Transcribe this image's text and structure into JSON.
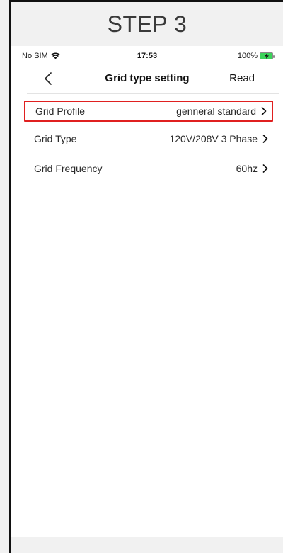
{
  "step_title": "STEP 3",
  "status_bar": {
    "carrier": "No SIM",
    "time": "17:53",
    "battery": "100%"
  },
  "nav": {
    "title": "Grid type setting",
    "action": "Read"
  },
  "settings": [
    {
      "label": "Grid Profile",
      "value": "genneral standard",
      "highlighted": true
    },
    {
      "label": "Grid Type",
      "value": "120V/208V 3 Phase",
      "highlighted": false
    },
    {
      "label": "Grid Frequency",
      "value": "60hz",
      "highlighted": false
    }
  ],
  "colors": {
    "highlight_border": "#e02020",
    "battery_fill": "#3bd35a"
  }
}
